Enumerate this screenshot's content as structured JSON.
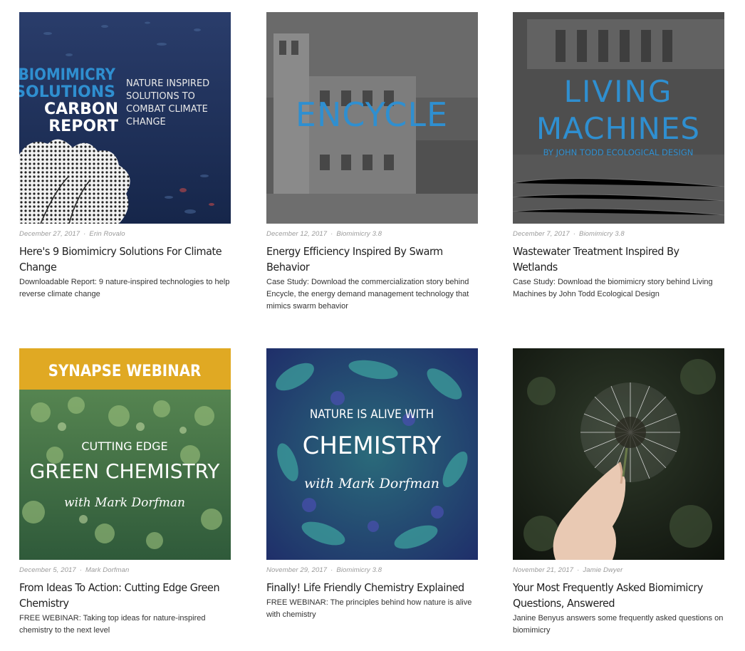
{
  "posts": [
    {
      "date": "December 27, 2017",
      "author": "Erin Rovalo",
      "title": "Here's 9 Biomimicry Solutions For Climate Change",
      "excerpt": "Downloadable Report: 9 nature-inspired technologies to help reverse climate change",
      "image": {
        "line1": "BIOMIMICRY",
        "line2": "SOLUTIONS",
        "line3": "CARBON",
        "line4": "REPORT",
        "side1": "NATURE INSPIRED",
        "side2": "SOLUTIONS TO",
        "side3": "COMBAT CLIMATE",
        "side4": "CHANGE"
      }
    },
    {
      "date": "December 12, 2017",
      "author": "Biomimicry 3.8",
      "title": "Energy Efficiency Inspired By Swarm Behavior",
      "excerpt": "Case Study: Download the commercialization story behind Encycle, the energy demand management technology that mimics swarm behavior",
      "image": {
        "line1": "ENCYCLE"
      }
    },
    {
      "date": "December 7, 2017",
      "author": "Biomimicry 3.8",
      "title": "Wastewater Treatment Inspired By Wetlands",
      "excerpt": "Case Study: Download the biomimicry story behind Living Machines by John Todd Ecological Design",
      "image": {
        "line1": "LIVING",
        "line2": "MACHINES",
        "line3": "BY JOHN TODD ECOLOGICAL DESIGN"
      }
    },
    {
      "date": "December 5, 2017",
      "author": "Mark Dorfman",
      "title": "From Ideas To Action: Cutting Edge Green Chemistry",
      "excerpt": "FREE WEBINAR: Taking top ideas for nature-inspired chemistry to the next level",
      "image": {
        "banner": "SYNAPSE WEBINAR",
        "line1": "CUTTING EDGE",
        "line2": "GREEN CHEMISTRY",
        "line3": "with Mark Dorfman"
      }
    },
    {
      "date": "November 29, 2017",
      "author": "Biomimicry 3.8",
      "title": "Finally! Life Friendly Chemistry Explained",
      "excerpt": "FREE WEBINAR: The principles behind how nature is alive with chemistry",
      "image": {
        "line1": "NATURE IS ALIVE WITH",
        "line2": "CHEMISTRY",
        "line3": "with Mark Dorfman"
      }
    },
    {
      "date": "November 21, 2017",
      "author": "Jamie Dwyer",
      "title": "Your Most Frequently Asked Biomimicry Questions, Answered",
      "excerpt": "Janine Benyus answers some frequently asked questions on biomimicry",
      "image": {}
    }
  ],
  "meta_separator": "·",
  "colors": {
    "accent_blue": "#2f8fd0",
    "webinar_gold": "#e0a923",
    "title_text": "#1f1f1f",
    "meta_text": "#9a9a9a"
  }
}
